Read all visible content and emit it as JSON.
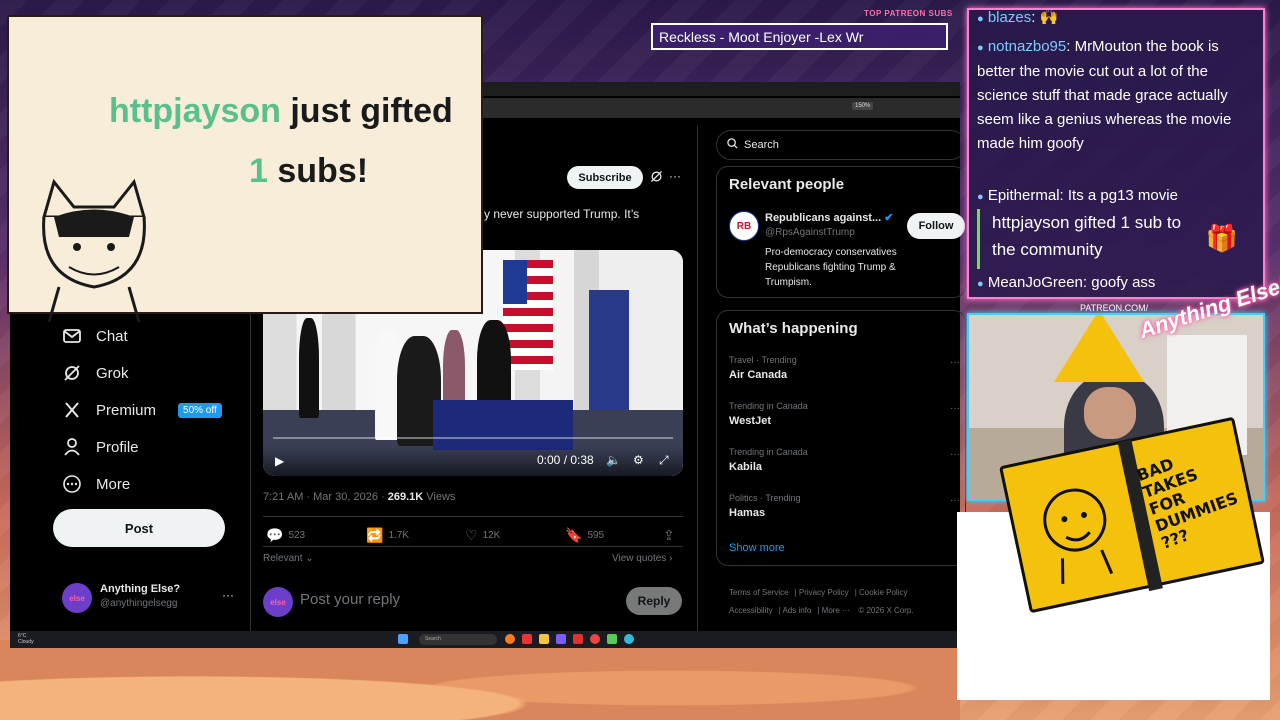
{
  "alert": {
    "username": "httpjayson",
    "message_part": " just gifted",
    "count": "1",
    "suffix": " subs!"
  },
  "patreon": {
    "label": "TOP PATREON SUBS",
    "ticker": "Reckless - Moot Enjoyer -Lex Wr"
  },
  "chat": {
    "messages": [
      {
        "user": "blazes",
        "text": ": 🙌"
      },
      {
        "user": "notnazbo95",
        "text": ": MrMouton the book is better the movie cut out a lot of the science stuff that made grace actually seem like a genius whereas the movie made him goofy"
      },
      {
        "user": "Epithermal",
        "text": ": Its a pg13 movie"
      },
      {
        "user": "MeanJoGreen",
        "text": ": goofy ass"
      }
    ],
    "gift": "httpjayson gifted 1 sub to the community"
  },
  "cam": {
    "label": "PATREON.COM/",
    "logo_text": "Anything Else?",
    "book_title": "BAD TAKES FOR DUMMIES ???"
  },
  "browser": {
    "zoom": "150%"
  },
  "nav": {
    "items": [
      {
        "label": "Chat",
        "icon": "mail-icon"
      },
      {
        "label": "Grok",
        "icon": "grok-icon"
      },
      {
        "label": "Premium",
        "icon": "x-logo-icon",
        "badge": "50% off"
      },
      {
        "label": "Profile",
        "icon": "person-icon"
      },
      {
        "label": "More",
        "icon": "more-circle-icon"
      }
    ],
    "post_label": "Post"
  },
  "account": {
    "avatar_text": "else",
    "name": "Anything Else?",
    "handle": "@anythingelsegg"
  },
  "tweet": {
    "subscribe_label": "Subscribe",
    "text": "y never supported Trump. It’s",
    "video_time": "0:00 / 0:38",
    "timestamp": "7:21 AM · Mar 30, 2026 · ",
    "views_count": "269.1K",
    "views_label": " Views",
    "replies": "523",
    "reposts": "1.7K",
    "likes": "12K",
    "bookmarks": "595",
    "relevant_label": "Relevant",
    "view_quotes_label": "View quotes",
    "reply_placeholder": "Post your reply",
    "reply_button": "Reply"
  },
  "sidebar": {
    "search_placeholder": "Search",
    "relevant_people_title": "Relevant people",
    "person": {
      "avatar_text": "RB",
      "name": "Republicans against...",
      "handle": "@RpsAgainstTrump",
      "bio": "Pro-democracy conservatives Republicans fighting Trump & Trumpism.",
      "follow_label": "Follow"
    },
    "happening_title": "What’s happening",
    "trends": [
      {
        "category": "Travel · Trending",
        "name": "Air Canada"
      },
      {
        "category": "Trending in Canada",
        "name": "WestJet"
      },
      {
        "category": "Trending in Canada",
        "name": "Kabila"
      },
      {
        "category": "Politics · Trending",
        "name": "Hamas"
      }
    ],
    "show_more": "Show more",
    "footer": [
      "Terms of Service",
      "Privacy Policy",
      "Cookie Policy",
      "Accessibility",
      "Ads info",
      "More ···",
      "© 2026 X Corp."
    ]
  },
  "taskbar": {
    "weather_temp": "6°C",
    "weather_desc": "Cloudy",
    "search": "Search"
  },
  "colors": {
    "accent": "#1d9bf0",
    "alert_green": "#59c08d",
    "chat_border": "#ff7fd0",
    "cam_border": "#40d0ff",
    "gift_bar": "#6fe05a"
  }
}
